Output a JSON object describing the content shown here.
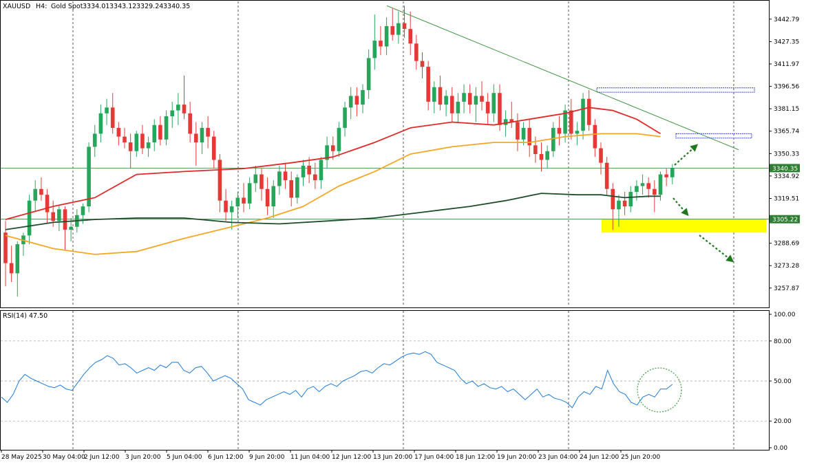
{
  "header": {
    "symbol": "XAUUSD",
    "timeframe": "H4:",
    "description": "Gold Spot",
    "open": "3334.01",
    "high": "3343.12",
    "low": "3329.24",
    "close": "3340.35"
  },
  "rsi_panel": {
    "label": "RSI(14) 47.50",
    "levels": [
      100,
      80,
      50,
      20,
      0
    ],
    "level_labels": [
      "100.00",
      "80.00",
      "50.00",
      "20.00",
      "0.00"
    ]
  },
  "colors": {
    "bull": "#26a65b",
    "bear": "#e53935",
    "ma_fast": "#e02a2a",
    "ma_mid": "#f5a623",
    "ma_slow": "#1e4d2b",
    "rsi_line": "#1e7ad6",
    "highlight_zone": "#ffff00",
    "resistance_box": "#2f3fd8",
    "trendline": "#2e8b2e",
    "arrow": "#1f7a1f",
    "price_tag_bg": "#2e7d32"
  },
  "chart_data": {
    "type": "candlestick",
    "symbol": "XAUUSD",
    "timeframe": "H4",
    "y_range": [
      3245,
      3455
    ],
    "y_ticks": [
      3442.79,
      3427.35,
      3411.97,
      3396.56,
      3381.15,
      3365.74,
      3350.33,
      3334.92,
      3319.51,
      3288.69,
      3273.28,
      3257.87
    ],
    "y_tick_labels": [
      "3442.79",
      "3427.35",
      "3411.97",
      "3396.56",
      "3381.15",
      "3365.74",
      "3350.33",
      "3334.92",
      "3319.51",
      "3288.69",
      "3273.28",
      "3257.87"
    ],
    "x_labels": [
      "28 May 2025",
      "30 May 04:00",
      "2 Jun 12:00",
      "3 Jun 20:00",
      "5 Jun 04:00",
      "6 Jun 12:00",
      "9 Jun 20:00",
      "11 Jun 04:00",
      "12 Jun 12:00",
      "13 Jun 20:00",
      "17 Jun 04:00",
      "18 Jun 12:00",
      "19 Jun 20:00",
      "23 Jun 04:00",
      "24 Jun 12:00",
      "25 Jun 20:00"
    ],
    "horizontal_lines": [
      {
        "price": 3340.35,
        "label": "3340.35"
      },
      {
        "price": 3305.22,
        "label": "3305.22"
      }
    ],
    "support_zone": {
      "top": 3305.22,
      "bottom": 3296.0
    },
    "resistance_zones": [
      {
        "top": 3395.5,
        "bottom": 3392.5
      },
      {
        "top": 3364.0,
        "bottom": 3361.0
      }
    ],
    "trendline": {
      "start_price": 3452.0,
      "end_price": 3353.0
    },
    "candles": [
      {
        "o": 3296,
        "h": 3304,
        "l": 3259,
        "c": 3275
      },
      {
        "o": 3275,
        "h": 3287,
        "l": 3262,
        "c": 3268
      },
      {
        "o": 3268,
        "h": 3290,
        "l": 3252,
        "c": 3288
      },
      {
        "o": 3288,
        "h": 3296,
        "l": 3280,
        "c": 3294
      },
      {
        "o": 3294,
        "h": 3322,
        "l": 3288,
        "c": 3318
      },
      {
        "o": 3318,
        "h": 3332,
        "l": 3310,
        "c": 3326
      },
      {
        "o": 3326,
        "h": 3334,
        "l": 3318,
        "c": 3322
      },
      {
        "o": 3322,
        "h": 3326,
        "l": 3302,
        "c": 3310
      },
      {
        "o": 3310,
        "h": 3318,
        "l": 3300,
        "c": 3304
      },
      {
        "o": 3304,
        "h": 3315,
        "l": 3297,
        "c": 3312
      },
      {
        "o": 3312,
        "h": 3314,
        "l": 3284,
        "c": 3298
      },
      {
        "o": 3298,
        "h": 3306,
        "l": 3290,
        "c": 3300
      },
      {
        "o": 3300,
        "h": 3312,
        "l": 3296,
        "c": 3308
      },
      {
        "o": 3308,
        "h": 3316,
        "l": 3302,
        "c": 3314
      },
      {
        "o": 3314,
        "h": 3358,
        "l": 3310,
        "c": 3355
      },
      {
        "o": 3355,
        "h": 3370,
        "l": 3348,
        "c": 3364
      },
      {
        "o": 3364,
        "h": 3384,
        "l": 3358,
        "c": 3378
      },
      {
        "o": 3378,
        "h": 3388,
        "l": 3370,
        "c": 3382
      },
      {
        "o": 3382,
        "h": 3392,
        "l": 3364,
        "c": 3368
      },
      {
        "o": 3368,
        "h": 3372,
        "l": 3356,
        "c": 3362
      },
      {
        "o": 3362,
        "h": 3368,
        "l": 3354,
        "c": 3358
      },
      {
        "o": 3358,
        "h": 3364,
        "l": 3340,
        "c": 3352
      },
      {
        "o": 3352,
        "h": 3366,
        "l": 3348,
        "c": 3364
      },
      {
        "o": 3364,
        "h": 3370,
        "l": 3350,
        "c": 3354
      },
      {
        "o": 3354,
        "h": 3362,
        "l": 3348,
        "c": 3358
      },
      {
        "o": 3358,
        "h": 3374,
        "l": 3352,
        "c": 3370
      },
      {
        "o": 3370,
        "h": 3376,
        "l": 3356,
        "c": 3360
      },
      {
        "o": 3360,
        "h": 3380,
        "l": 3356,
        "c": 3376
      },
      {
        "o": 3376,
        "h": 3386,
        "l": 3368,
        "c": 3380
      },
      {
        "o": 3380,
        "h": 3392,
        "l": 3370,
        "c": 3384
      },
      {
        "o": 3384,
        "h": 3404,
        "l": 3374,
        "c": 3378
      },
      {
        "o": 3378,
        "h": 3386,
        "l": 3358,
        "c": 3364
      },
      {
        "o": 3364,
        "h": 3372,
        "l": 3342,
        "c": 3358
      },
      {
        "o": 3358,
        "h": 3372,
        "l": 3350,
        "c": 3368
      },
      {
        "o": 3368,
        "h": 3376,
        "l": 3354,
        "c": 3362
      },
      {
        "o": 3362,
        "h": 3366,
        "l": 3340,
        "c": 3346
      },
      {
        "o": 3346,
        "h": 3350,
        "l": 3310,
        "c": 3318
      },
      {
        "o": 3318,
        "h": 3326,
        "l": 3304,
        "c": 3310
      },
      {
        "o": 3310,
        "h": 3318,
        "l": 3298,
        "c": 3314
      },
      {
        "o": 3314,
        "h": 3324,
        "l": 3306,
        "c": 3320
      },
      {
        "o": 3320,
        "h": 3330,
        "l": 3310,
        "c": 3316
      },
      {
        "o": 3316,
        "h": 3334,
        "l": 3312,
        "c": 3330
      },
      {
        "o": 3330,
        "h": 3342,
        "l": 3324,
        "c": 3336
      },
      {
        "o": 3336,
        "h": 3340,
        "l": 3318,
        "c": 3326
      },
      {
        "o": 3326,
        "h": 3334,
        "l": 3308,
        "c": 3314
      },
      {
        "o": 3314,
        "h": 3332,
        "l": 3306,
        "c": 3328
      },
      {
        "o": 3328,
        "h": 3342,
        "l": 3322,
        "c": 3338
      },
      {
        "o": 3338,
        "h": 3344,
        "l": 3326,
        "c": 3332
      },
      {
        "o": 3332,
        "h": 3338,
        "l": 3314,
        "c": 3320
      },
      {
        "o": 3320,
        "h": 3336,
        "l": 3316,
        "c": 3334
      },
      {
        "o": 3334,
        "h": 3346,
        "l": 3328,
        "c": 3342
      },
      {
        "o": 3342,
        "h": 3348,
        "l": 3330,
        "c": 3336
      },
      {
        "o": 3336,
        "h": 3344,
        "l": 3326,
        "c": 3332
      },
      {
        "o": 3332,
        "h": 3348,
        "l": 3326,
        "c": 3346
      },
      {
        "o": 3346,
        "h": 3362,
        "l": 3340,
        "c": 3356
      },
      {
        "o": 3356,
        "h": 3362,
        "l": 3346,
        "c": 3352
      },
      {
        "o": 3352,
        "h": 3372,
        "l": 3348,
        "c": 3368
      },
      {
        "o": 3368,
        "h": 3386,
        "l": 3362,
        "c": 3382
      },
      {
        "o": 3382,
        "h": 3396,
        "l": 3374,
        "c": 3390
      },
      {
        "o": 3390,
        "h": 3396,
        "l": 3376,
        "c": 3384
      },
      {
        "o": 3384,
        "h": 3398,
        "l": 3378,
        "c": 3394
      },
      {
        "o": 3394,
        "h": 3422,
        "l": 3388,
        "c": 3416
      },
      {
        "o": 3416,
        "h": 3446,
        "l": 3408,
        "c": 3428
      },
      {
        "o": 3428,
        "h": 3438,
        "l": 3418,
        "c": 3424
      },
      {
        "o": 3424,
        "h": 3444,
        "l": 3418,
        "c": 3438
      },
      {
        "o": 3438,
        "h": 3450,
        "l": 3428,
        "c": 3432
      },
      {
        "o": 3432,
        "h": 3448,
        "l": 3426,
        "c": 3440
      },
      {
        "o": 3440,
        "h": 3452,
        "l": 3430,
        "c": 3436
      },
      {
        "o": 3436,
        "h": 3448,
        "l": 3418,
        "c": 3426
      },
      {
        "o": 3426,
        "h": 3432,
        "l": 3408,
        "c": 3414
      },
      {
        "o": 3414,
        "h": 3420,
        "l": 3402,
        "c": 3410
      },
      {
        "o": 3410,
        "h": 3414,
        "l": 3380,
        "c": 3386
      },
      {
        "o": 3386,
        "h": 3400,
        "l": 3378,
        "c": 3396
      },
      {
        "o": 3396,
        "h": 3404,
        "l": 3380,
        "c": 3384
      },
      {
        "o": 3384,
        "h": 3394,
        "l": 3376,
        "c": 3390
      },
      {
        "o": 3390,
        "h": 3396,
        "l": 3372,
        "c": 3378
      },
      {
        "o": 3378,
        "h": 3392,
        "l": 3372,
        "c": 3386
      },
      {
        "o": 3386,
        "h": 3398,
        "l": 3378,
        "c": 3392
      },
      {
        "o": 3392,
        "h": 3398,
        "l": 3378,
        "c": 3384
      },
      {
        "o": 3384,
        "h": 3396,
        "l": 3372,
        "c": 3390
      },
      {
        "o": 3390,
        "h": 3400,
        "l": 3380,
        "c": 3386
      },
      {
        "o": 3386,
        "h": 3392,
        "l": 3370,
        "c": 3378
      },
      {
        "o": 3378,
        "h": 3398,
        "l": 3372,
        "c": 3392
      },
      {
        "o": 3392,
        "h": 3398,
        "l": 3366,
        "c": 3370
      },
      {
        "o": 3370,
        "h": 3380,
        "l": 3362,
        "c": 3374
      },
      {
        "o": 3374,
        "h": 3386,
        "l": 3368,
        "c": 3372
      },
      {
        "o": 3372,
        "h": 3378,
        "l": 3352,
        "c": 3360
      },
      {
        "o": 3360,
        "h": 3372,
        "l": 3356,
        "c": 3368
      },
      {
        "o": 3368,
        "h": 3374,
        "l": 3348,
        "c": 3356
      },
      {
        "o": 3356,
        "h": 3362,
        "l": 3344,
        "c": 3350
      },
      {
        "o": 3350,
        "h": 3358,
        "l": 3338,
        "c": 3346
      },
      {
        "o": 3346,
        "h": 3356,
        "l": 3340,
        "c": 3352
      },
      {
        "o": 3352,
        "h": 3372,
        "l": 3348,
        "c": 3368
      },
      {
        "o": 3368,
        "h": 3376,
        "l": 3356,
        "c": 3364
      },
      {
        "o": 3364,
        "h": 3384,
        "l": 3358,
        "c": 3380
      },
      {
        "o": 3380,
        "h": 3388,
        "l": 3360,
        "c": 3364
      },
      {
        "o": 3364,
        "h": 3372,
        "l": 3356,
        "c": 3366
      },
      {
        "o": 3366,
        "h": 3392,
        "l": 3360,
        "c": 3388
      },
      {
        "o": 3388,
        "h": 3394,
        "l": 3366,
        "c": 3370
      },
      {
        "o": 3370,
        "h": 3374,
        "l": 3348,
        "c": 3354
      },
      {
        "o": 3354,
        "h": 3358,
        "l": 3336,
        "c": 3344
      },
      {
        "o": 3344,
        "h": 3348,
        "l": 3322,
        "c": 3326
      },
      {
        "o": 3326,
        "h": 3330,
        "l": 3298,
        "c": 3312
      },
      {
        "o": 3312,
        "h": 3322,
        "l": 3300,
        "c": 3318
      },
      {
        "o": 3318,
        "h": 3324,
        "l": 3308,
        "c": 3314
      },
      {
        "o": 3314,
        "h": 3328,
        "l": 3310,
        "c": 3324
      },
      {
        "o": 3324,
        "h": 3332,
        "l": 3318,
        "c": 3328
      },
      {
        "o": 3328,
        "h": 3336,
        "l": 3322,
        "c": 3330
      },
      {
        "o": 3330,
        "h": 3334,
        "l": 3320,
        "c": 3326
      },
      {
        "o": 3326,
        "h": 3332,
        "l": 3310,
        "c": 3322
      },
      {
        "o": 3322,
        "h": 3338,
        "l": 3318,
        "c": 3336
      },
      {
        "o": 3336,
        "h": 3340,
        "l": 3328,
        "c": 3334
      },
      {
        "o": 3334.01,
        "h": 3343.12,
        "l": 3329.24,
        "c": 3340.35
      }
    ],
    "ma_fast": {
      "points": [
        [
          0,
          3305
        ],
        [
          8,
          3314
        ],
        [
          15,
          3320
        ],
        [
          22,
          3336
        ],
        [
          30,
          3338
        ],
        [
          40,
          3340
        ],
        [
          48,
          3344
        ],
        [
          55,
          3348
        ],
        [
          62,
          3358
        ],
        [
          68,
          3368
        ],
        [
          75,
          3372
        ],
        [
          82,
          3370
        ],
        [
          88,
          3374
        ],
        [
          94,
          3378
        ],
        [
          98,
          3382
        ],
        [
          102,
          3380
        ],
        [
          106,
          3374
        ],
        [
          110,
          3364
        ]
      ]
    },
    "ma_mid": {
      "points": [
        [
          0,
          3294
        ],
        [
          8,
          3285
        ],
        [
          15,
          3281
        ],
        [
          22,
          3283
        ],
        [
          30,
          3292
        ],
        [
          38,
          3300
        ],
        [
          44,
          3306
        ],
        [
          50,
          3314
        ],
        [
          56,
          3328
        ],
        [
          62,
          3338
        ],
        [
          68,
          3350
        ],
        [
          75,
          3355
        ],
        [
          82,
          3358
        ],
        [
          88,
          3358
        ],
        [
          94,
          3362
        ],
        [
          100,
          3364
        ],
        [
          106,
          3364
        ],
        [
          110,
          3362
        ]
      ]
    },
    "ma_slow": {
      "points": [
        [
          0,
          3298
        ],
        [
          8,
          3303
        ],
        [
          15,
          3305
        ],
        [
          22,
          3306
        ],
        [
          30,
          3306
        ],
        [
          38,
          3303
        ],
        [
          46,
          3302
        ],
        [
          54,
          3304
        ],
        [
          62,
          3306
        ],
        [
          70,
          3310
        ],
        [
          78,
          3314
        ],
        [
          84,
          3318
        ],
        [
          90,
          3323
        ],
        [
          96,
          3322
        ],
        [
          100,
          3322
        ],
        [
          104,
          3320
        ],
        [
          108,
          3321
        ],
        [
          110,
          3321
        ]
      ]
    },
    "rsi": {
      "name": "RSI(14)",
      "last": 47.5,
      "ylim": [
        0,
        100
      ],
      "values": [
        38,
        34,
        40,
        50,
        55,
        52,
        50,
        48,
        46,
        45,
        47,
        44,
        43,
        49,
        55,
        60,
        64,
        66,
        69,
        67,
        62,
        63,
        60,
        56,
        58,
        60,
        58,
        62,
        60,
        64,
        64,
        58,
        56,
        60,
        61,
        56,
        50,
        52,
        54,
        52,
        48,
        44,
        36,
        34,
        32,
        36,
        38,
        40,
        42,
        40,
        43,
        38,
        44,
        46,
        42,
        46,
        48,
        46,
        50,
        52,
        54,
        57,
        58,
        56,
        60,
        63,
        62,
        65,
        68,
        70,
        71,
        70,
        72,
        70,
        64,
        62,
        60,
        58,
        52,
        48,
        50,
        46,
        48,
        45,
        44,
        46,
        42,
        44,
        40,
        36,
        40,
        44,
        38,
        40,
        37,
        36,
        34,
        30,
        38,
        42,
        40,
        46,
        44,
        58,
        48,
        42,
        40,
        34,
        32,
        38,
        40,
        38,
        44,
        44,
        47.5
      ]
    }
  }
}
